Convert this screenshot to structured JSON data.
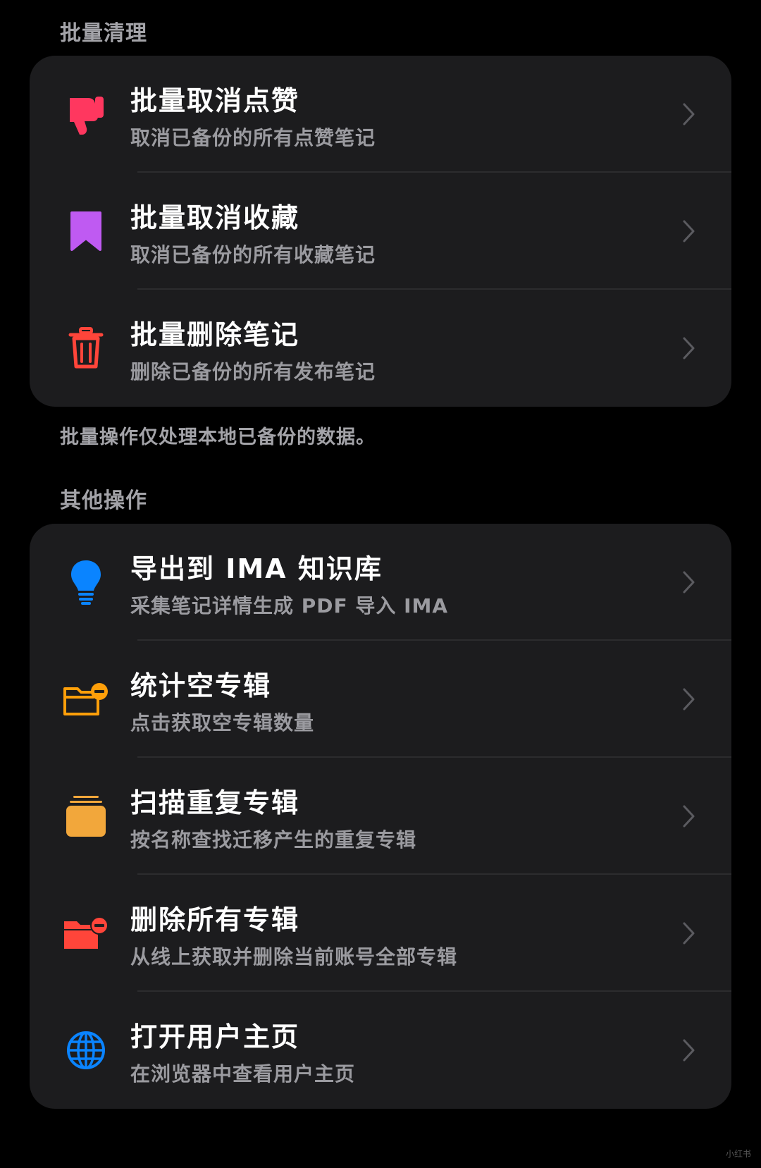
{
  "sections": [
    {
      "header": "批量清理",
      "items": [
        {
          "icon": "thumbs-down-icon",
          "title": "批量取消点赞",
          "subtitle": "取消已备份的所有点赞笔记"
        },
        {
          "icon": "bookmark-icon",
          "title": "批量取消收藏",
          "subtitle": "取消已备份的所有收藏笔记"
        },
        {
          "icon": "trash-icon",
          "title": "批量删除笔记",
          "subtitle": "删除已备份的所有发布笔记"
        }
      ],
      "footnote": "批量操作仅处理本地已备份的数据。"
    },
    {
      "header": "其他操作",
      "items": [
        {
          "icon": "lightbulb-icon",
          "title": "导出到 IMA 知识库",
          "subtitle": "采集笔记详情生成 PDF 导入 IMA"
        },
        {
          "icon": "folder-minus-outline-icon",
          "title": "统计空专辑",
          "subtitle": "点击获取空专辑数量"
        },
        {
          "icon": "stack-icon",
          "title": "扫描重复专辑",
          "subtitle": "按名称查找迁移产生的重复专辑"
        },
        {
          "icon": "folder-minus-filled-icon",
          "title": "删除所有专辑",
          "subtitle": "从线上获取并删除当前账号全部专辑"
        },
        {
          "icon": "globe-icon",
          "title": "打开用户主页",
          "subtitle": "在浏览器中查看用户主页"
        }
      ]
    }
  ],
  "colors": {
    "background": "#000000",
    "card": "#1c1c1e",
    "thumbs_down": "#ff375f",
    "bookmark": "#bf5af2",
    "trash": "#ff453a",
    "lightbulb": "#0a84ff",
    "folder_outline": "#ff9f0a",
    "stack": "#f2a73b",
    "folder_filled": "#ff453a",
    "globe": "#0a84ff"
  },
  "watermark": "小红书"
}
